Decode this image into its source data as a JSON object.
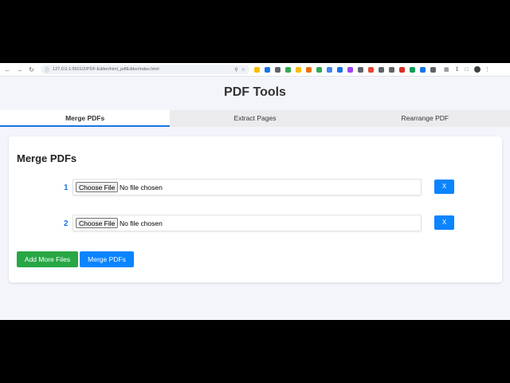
{
  "browser": {
    "url": "127.0.0.1:5501/2/PDF-Editor/html_pdfEditor/index.html",
    "extension_colors": [
      "#fbbc04",
      "#1a73e8",
      "#5f6368",
      "#34a853",
      "#fbbc04",
      "#e8710a",
      "#34a853",
      "#4285f4",
      "#1a73e8",
      "#a142f4",
      "#5f6368",
      "#ea4335",
      "#5f6368",
      "#5f6368",
      "#d93025",
      "#0f9d58",
      "#1a73e8",
      "#5f6368"
    ]
  },
  "page": {
    "title": "PDF Tools"
  },
  "tabs": [
    {
      "label": "Merge PDFs",
      "active": true
    },
    {
      "label": "Extract Pages",
      "active": false
    },
    {
      "label": "Rearrange PDF",
      "active": false
    }
  ],
  "merge": {
    "heading": "Merge PDFs",
    "rows": [
      {
        "number": "1",
        "choose_label": "Choose File",
        "status": "No file chosen",
        "remove_label": "X"
      },
      {
        "number": "2",
        "choose_label": "Choose File",
        "status": "No file chosen",
        "remove_label": "X"
      }
    ],
    "add_more_label": "Add More Files",
    "merge_label": "Merge PDFs"
  },
  "colors": {
    "accent": "#1a73e8",
    "primary_button": "#0b84ff",
    "success_button": "#28a745",
    "page_background": "#f4f5fb"
  }
}
